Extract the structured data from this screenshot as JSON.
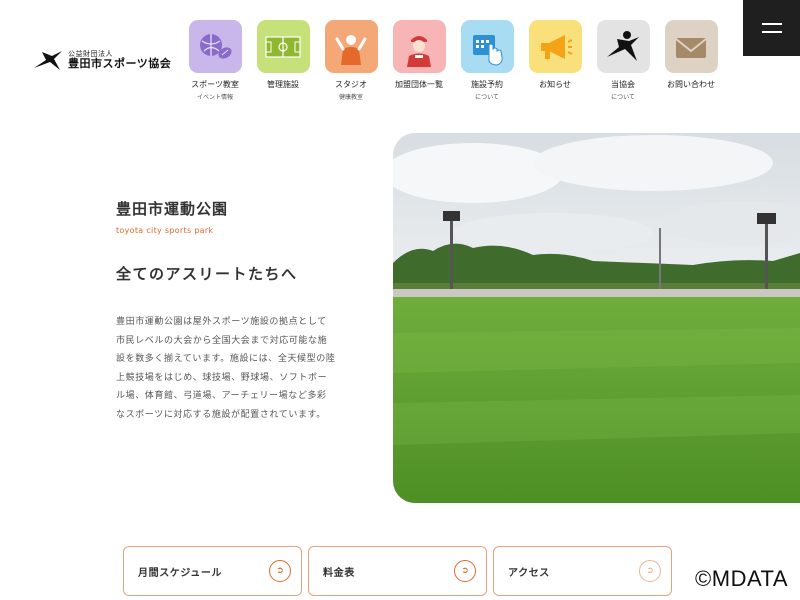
{
  "logo": {
    "sub": "公益財団法人",
    "main": "豊田市スポーツ協会",
    "icon": "runner-logo-icon"
  },
  "nav": [
    {
      "label": "スポーツ教室",
      "sub": "イベント情報",
      "icon": "sports-balls-icon",
      "color": "#c9b6ea"
    },
    {
      "label": "管理施設",
      "sub": "",
      "icon": "soccer-field-icon",
      "color": "#c6e07a"
    },
    {
      "label": "スタジオ",
      "sub": "健康教室",
      "icon": "studio-icon",
      "color": "#f5a877"
    },
    {
      "label": "加盟団体一覧",
      "sub": "",
      "icon": "member-person-icon",
      "color": "#f7b5b5"
    },
    {
      "label": "施設予約",
      "sub": "について",
      "icon": "calendar-tap-icon",
      "color": "#a8dcf2"
    },
    {
      "label": "お知らせ",
      "sub": "",
      "icon": "megaphone-icon",
      "color": "#fae07a"
    },
    {
      "label": "当協会",
      "sub": "について",
      "icon": "runner-icon",
      "color": "#e3e3e3"
    },
    {
      "label": "お問い合わせ",
      "sub": "",
      "icon": "envelope-icon",
      "color": "#ddd2c3"
    }
  ],
  "main": {
    "title": "豊田市運動公園",
    "subtitle": "toyota city sports park",
    "catch": "全てのアスリートたちへ",
    "description": "豊田市運動公園は屋外スポーツ施設の拠点として市民レベルの大会から全国大会まで対応可能な施設を数多く揃えています。施設には、全天候型の陸上競技場をはじめ、球技場、野球場、ソフトボール場、体育館、弓道場、アーチェリー場など多彩なスポーツに対応する施設が配置されています。"
  },
  "buttons": [
    {
      "label": "月間スケジュール",
      "icon": "arrow-right-icon"
    },
    {
      "label": "料金表",
      "icon": "arrow-right-icon"
    },
    {
      "label": "アクセス",
      "icon": "arrow-right-icon"
    }
  ],
  "copyright": "©MDATA",
  "colors": {
    "accent": "#e0682a",
    "menu_bg": "#1f1f1f"
  }
}
